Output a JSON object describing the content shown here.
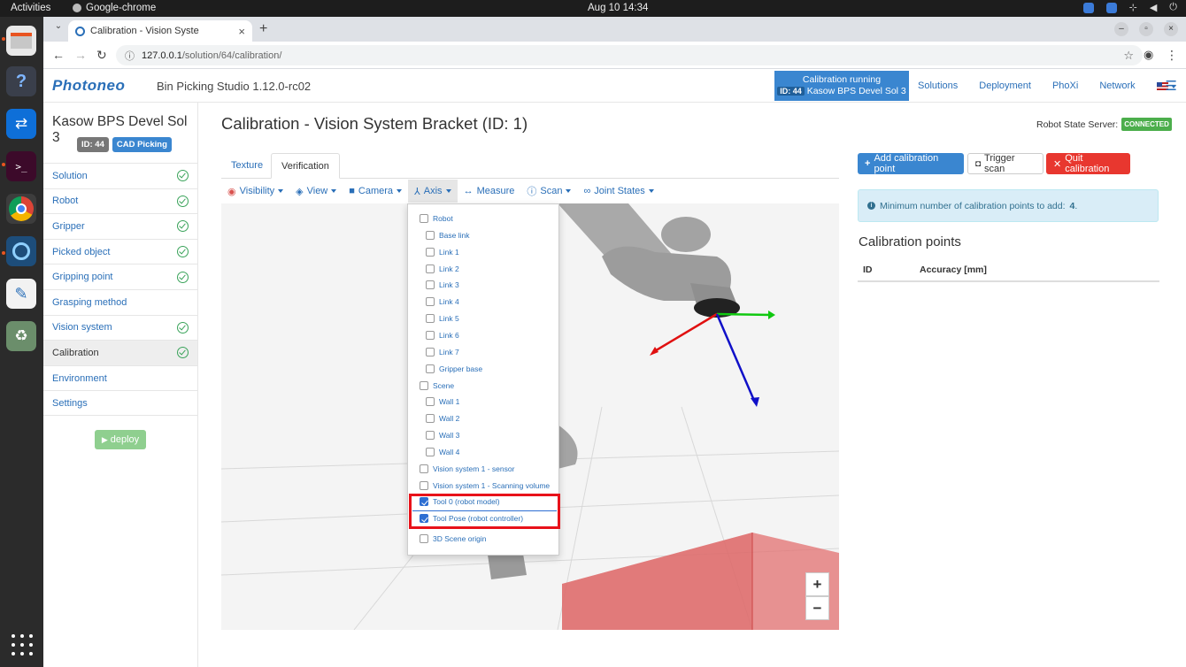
{
  "os": {
    "activities": "Activities",
    "app_name": "Google-chrome",
    "clock": "Aug 10  14:34"
  },
  "browser": {
    "tab_title": "Calibration - Vision Syste",
    "url_host": "127.0.0.1",
    "url_path": "/solution/64/calibration/"
  },
  "app": {
    "logo": "Photoneo",
    "title": "Bin Picking Studio 1.12.0-rc02",
    "calib_status": "Calibration running",
    "calib_id_badge": "ID: 44",
    "calib_solution": "Kasow BPS Devel Sol 3",
    "nav": [
      "Solutions",
      "Deployment",
      "PhoXi",
      "Network"
    ]
  },
  "sidebar": {
    "title": "Kasow BPS Devel Sol 3",
    "id_badge": "ID: 44",
    "type_badge": "CAD Picking",
    "items": [
      {
        "label": "Solution",
        "done": true
      },
      {
        "label": "Robot",
        "done": true
      },
      {
        "label": "Gripper",
        "done": true
      },
      {
        "label": "Picked object",
        "done": true
      },
      {
        "label": "Gripping point",
        "done": true
      },
      {
        "label": "Grasping method",
        "done": false
      },
      {
        "label": "Vision system",
        "done": true
      },
      {
        "label": "Calibration",
        "done": true,
        "active": true
      },
      {
        "label": "Environment",
        "done": false
      },
      {
        "label": "Settings",
        "done": false
      }
    ],
    "deploy": "deploy"
  },
  "main": {
    "title": "Calibration - Vision System Bracket (ID: 1)",
    "robot_state_label": "Robot State Server:",
    "robot_state_value": "CONNECTED",
    "tabs": [
      "Texture",
      "Verification"
    ],
    "toolbar": [
      "Visibility",
      "View",
      "Camera",
      "Axis",
      "Measure",
      "Scan",
      "Joint States"
    ],
    "axis_menu": [
      {
        "label": "Robot",
        "checked": false,
        "indent": 0
      },
      {
        "label": "Base link",
        "checked": false,
        "indent": 1
      },
      {
        "label": "Link 1",
        "checked": false,
        "indent": 1
      },
      {
        "label": "Link 2",
        "checked": false,
        "indent": 1
      },
      {
        "label": "Link 3",
        "checked": false,
        "indent": 1
      },
      {
        "label": "Link 4",
        "checked": false,
        "indent": 1
      },
      {
        "label": "Link 5",
        "checked": false,
        "indent": 1
      },
      {
        "label": "Link 6",
        "checked": false,
        "indent": 1
      },
      {
        "label": "Link 7",
        "checked": false,
        "indent": 1
      },
      {
        "label": "Gripper base",
        "checked": false,
        "indent": 1
      },
      {
        "label": "Scene",
        "checked": false,
        "indent": 0
      },
      {
        "label": "Wall 1",
        "checked": false,
        "indent": 1
      },
      {
        "label": "Wall 2",
        "checked": false,
        "indent": 1
      },
      {
        "label": "Wall 3",
        "checked": false,
        "indent": 1
      },
      {
        "label": "Wall 4",
        "checked": false,
        "indent": 1
      },
      {
        "label": "Vision system 1 - sensor",
        "checked": false,
        "indent": 0
      },
      {
        "label": "Vision system 1 - Scanning volume",
        "checked": false,
        "indent": 0
      },
      {
        "label": "Tool 0 (robot model)",
        "checked": true,
        "indent": 0
      },
      {
        "label": "Tool Pose (robot controller)",
        "checked": true,
        "indent": 0
      },
      {
        "label": "3D Scene origin",
        "checked": false,
        "indent": 0
      }
    ],
    "zoom_in": "+",
    "zoom_out": "−"
  },
  "right": {
    "add_point": "Add calibration point",
    "trigger_scan": "Trigger scan",
    "quit": "Quit calibration",
    "info_prefix": "Minimum number of calibration points to add:",
    "info_count": "4",
    "info_suffix": ".",
    "points_title": "Calibration points",
    "col_id": "ID",
    "col_accuracy": "Accuracy [mm]"
  },
  "colors": {
    "link": "#2a6fb8",
    "primary": "#3a86d0",
    "danger": "#e8372f",
    "success": "#4cae4c",
    "highlight": "#e8121a"
  }
}
